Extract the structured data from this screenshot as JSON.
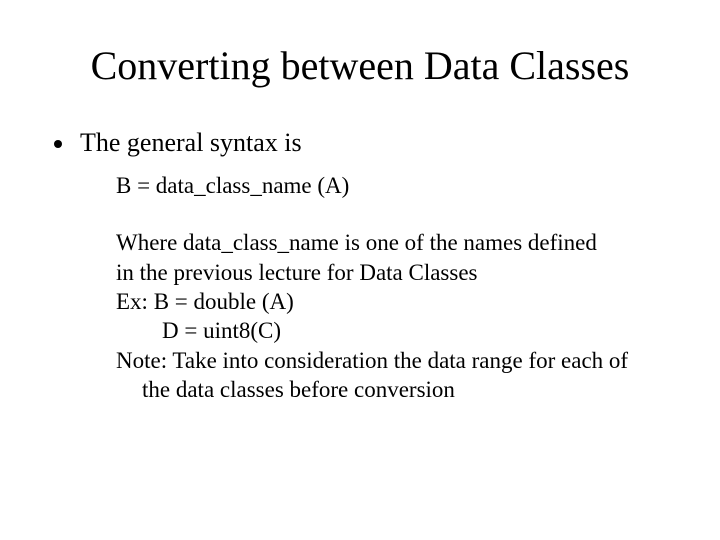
{
  "title": "Converting between Data Classes",
  "bullet1": "The general syntax is",
  "syntax": "B = data_class_name (A)",
  "where_l1": "Where data_class_name is one of the names defined",
  "where_l2": "in the previous lecture for Data Classes",
  "ex_label": "Ex: B = double (A)",
  "ex_line2": "D = uint8(C)",
  "note_l1": "Note: Take into consideration the data range for each of",
  "note_l2": "the data classes before conversion"
}
